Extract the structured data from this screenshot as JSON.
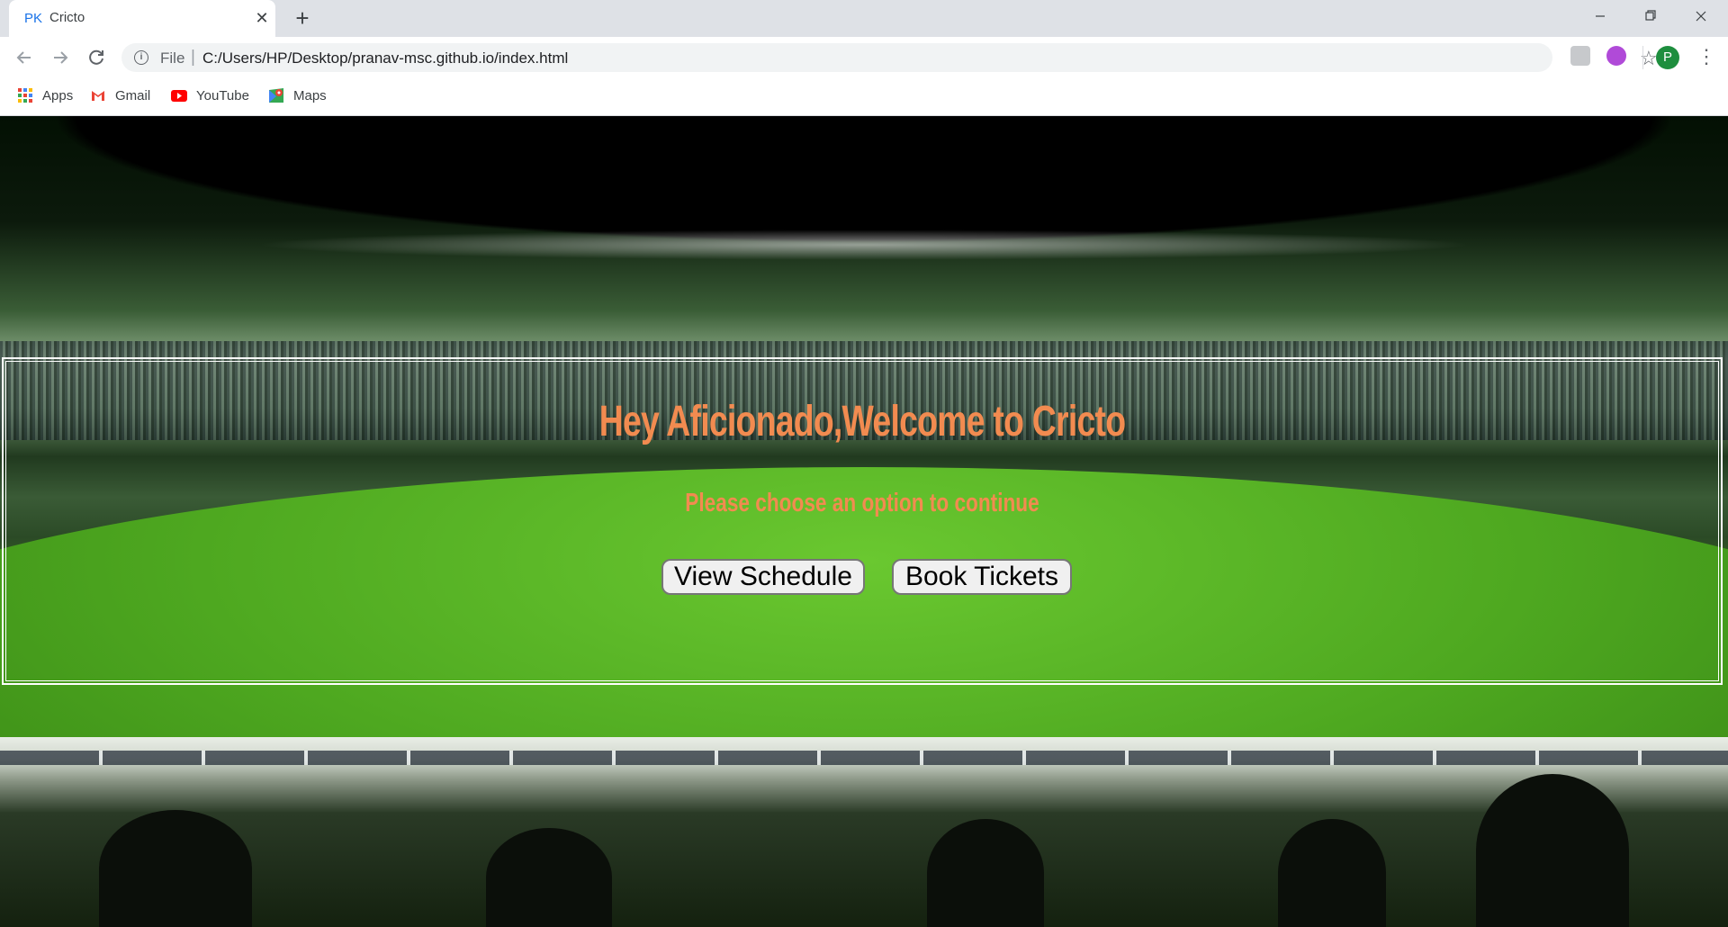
{
  "browser": {
    "tab": {
      "favicon_text": "PK",
      "title": "Cricto",
      "close_symbol": "✕"
    },
    "new_tab_symbol": "+",
    "window_controls": {
      "minimize": "—",
      "maximize": "❐",
      "close": "✕"
    },
    "omnibox": {
      "info_icon": "i",
      "scheme_label": "File",
      "separator": "|",
      "url": "C:/Users/HP/Desktop/pranav-msc.github.io/index.html"
    },
    "profile_initial": "P",
    "bookmarks": [
      {
        "label": "Apps",
        "icon": "apps-grid-icon"
      },
      {
        "label": "Gmail",
        "icon": "gmail-icon"
      },
      {
        "label": "YouTube",
        "icon": "youtube-icon"
      },
      {
        "label": "Maps",
        "icon": "maps-icon"
      }
    ]
  },
  "page": {
    "headline": "Hey Aficionado,Welcome to Cricto",
    "subline": "Please choose an option to continue",
    "buttons": {
      "view_schedule": "View Schedule",
      "book_tickets": "Book Tickets"
    }
  },
  "colors": {
    "headline": "#f28b50",
    "box_border": "#ffffff",
    "button_bg": "#f0f0f0",
    "tab_favicon": "#1a73e8"
  }
}
